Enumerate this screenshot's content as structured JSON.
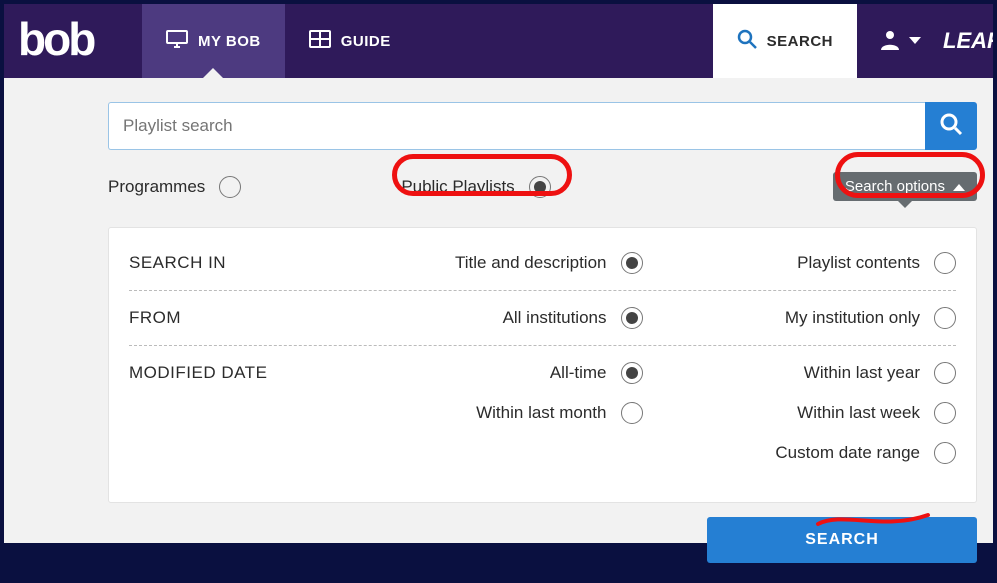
{
  "header": {
    "logo_text": "bob",
    "nav": {
      "mybob": "MY BOB",
      "guide": "GUIDE",
      "search": "SEARCH"
    },
    "learning_text": "LEARNING ON SCREEN"
  },
  "search": {
    "placeholder": "Playlist search",
    "options_label": "Search options",
    "button": "SEARCH"
  },
  "type": {
    "programmes": "Programmes",
    "public_playlists": "Public Playlists"
  },
  "panel": {
    "search_in": {
      "label": "SEARCH IN",
      "opt1": "Title and description",
      "opt2": "Playlist contents"
    },
    "from": {
      "label": "FROM",
      "opt1": "All institutions",
      "opt2": "My institution only"
    },
    "modified": {
      "label": "MODIFIED DATE",
      "opt1": "All-time",
      "opt2": "Within last year",
      "opt3": "Within last month",
      "opt4": "Within last week",
      "opt5": "Custom date range"
    }
  }
}
